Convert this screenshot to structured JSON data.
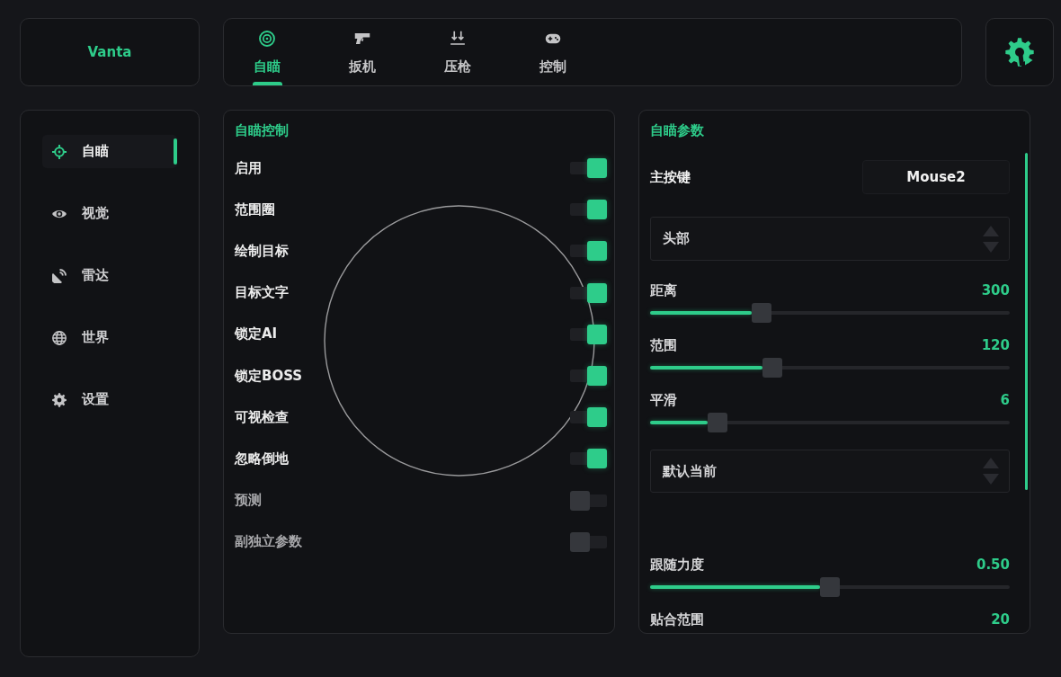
{
  "brand": {
    "name": "Vanta"
  },
  "tabs": [
    {
      "label": "自瞄",
      "selected": true
    },
    {
      "label": "扳机",
      "selected": false
    },
    {
      "label": "压枪",
      "selected": false
    },
    {
      "label": "控制",
      "selected": false
    }
  ],
  "sidebar": {
    "items": [
      {
        "label": "自瞄",
        "selected": true
      },
      {
        "label": "视觉",
        "selected": false
      },
      {
        "label": "雷达",
        "selected": false
      },
      {
        "label": "世界",
        "selected": false
      },
      {
        "label": "设置",
        "selected": false
      }
    ]
  },
  "aim_control": {
    "title": "自瞄控制",
    "toggles": [
      {
        "label": "启用",
        "on": true
      },
      {
        "label": "范围圈",
        "on": true
      },
      {
        "label": "绘制目标",
        "on": true
      },
      {
        "label": "目标文字",
        "on": true
      },
      {
        "label": "锁定AI",
        "on": true
      },
      {
        "label": "锁定BOSS",
        "on": true
      },
      {
        "label": "可视检查",
        "on": true
      },
      {
        "label": "忽略倒地",
        "on": true
      },
      {
        "label": "预测",
        "on": false
      },
      {
        "label": "副独立参数",
        "on": false
      }
    ]
  },
  "aim_params": {
    "title": "自瞄参数",
    "items": [
      {
        "kind": "keybind",
        "label": "主按键",
        "value": "Mouse2"
      },
      {
        "kind": "select",
        "value": "头部"
      },
      {
        "kind": "slider",
        "label": "距离",
        "reading": "300",
        "level": 0.3
      },
      {
        "kind": "slider",
        "label": "范围",
        "reading": "120",
        "level": 0.33
      },
      {
        "kind": "slider",
        "label": "平滑",
        "reading": "6",
        "level": 0.17
      },
      {
        "kind": "select",
        "value": "默认当前"
      },
      {
        "kind": "slider",
        "label": "跟随力度",
        "reading": "0.50",
        "level": 0.5
      },
      {
        "kind": "slider",
        "label": "贴合范围",
        "reading": "20"
      }
    ]
  }
}
